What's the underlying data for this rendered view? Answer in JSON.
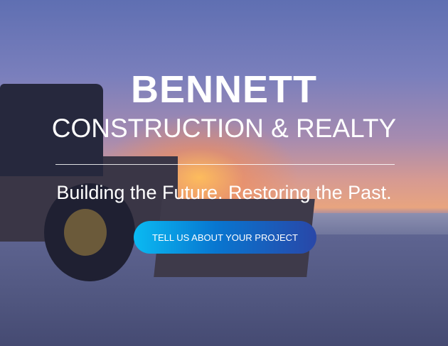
{
  "hero": {
    "title": "BENNETT",
    "subtitle": "CONSTRUCTION & REALTY",
    "tagline": "Building the Future. Restoring the Past.",
    "cta_label": "TELL US ABOUT YOUR PROJECT",
    "colors": {
      "cta_start": "#0abaf2",
      "cta_end": "#2947a8",
      "text": "#ffffff"
    }
  }
}
